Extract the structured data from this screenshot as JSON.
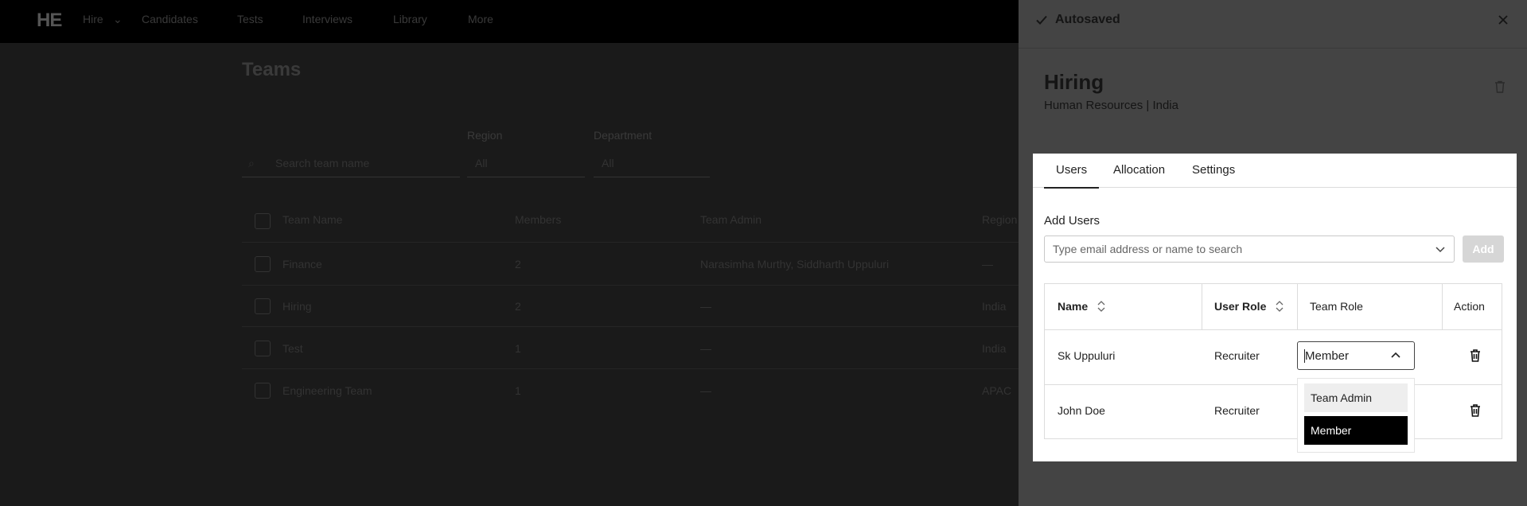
{
  "nav": {
    "logo": "HE",
    "items": [
      "Hire",
      "Candidates",
      "Tests",
      "Interviews",
      "Library",
      "More"
    ]
  },
  "background": {
    "title": "Teams",
    "search_placeholder": "Search team name",
    "region_label": "Region",
    "region_value": "All",
    "department_label": "Department",
    "department_value": "All",
    "columns": [
      "Team Name",
      "Members",
      "Team Admin",
      "Region"
    ],
    "rows": [
      {
        "name": "Finance",
        "members": "2",
        "admin": "Narasimha Murthy, Siddharth Uppuluri",
        "region": "—"
      },
      {
        "name": "Hiring",
        "members": "2",
        "admin": "—",
        "region": "India"
      },
      {
        "name": "Test",
        "members": "1",
        "admin": "—",
        "region": "India"
      },
      {
        "name": "Engineering Team",
        "members": "1",
        "admin": "—",
        "region": "APAC"
      }
    ]
  },
  "drawer": {
    "status": "Autosaved",
    "team_name": "Hiring",
    "team_meta": "Human Resources | India",
    "tabs": [
      "Users",
      "Allocation",
      "Settings"
    ],
    "active_tab": "Users",
    "add_users_label": "Add Users",
    "search_placeholder": "Type email address or name to search",
    "add_button": "Add",
    "table": {
      "headers": {
        "name": "Name",
        "user_role": "User Role",
        "team_role": "Team Role",
        "action": "Action"
      },
      "rows": [
        {
          "name": "Sk Uppuluri",
          "user_role": "Recruiter",
          "team_role": "Member"
        },
        {
          "name": "John Doe",
          "user_role": "Recruiter",
          "team_role": "Member"
        }
      ]
    },
    "role_dropdown": {
      "value": "Member",
      "options": [
        "Team Admin",
        "Member"
      ],
      "selected": "Member"
    }
  },
  "colors": {
    "overlay_bg": "#1d1d1d",
    "drawer_bg": "#444444",
    "card_bg": "#ffffff",
    "selected_option_bg": "#000000",
    "add_button_disabled": "#d6d6d6"
  }
}
